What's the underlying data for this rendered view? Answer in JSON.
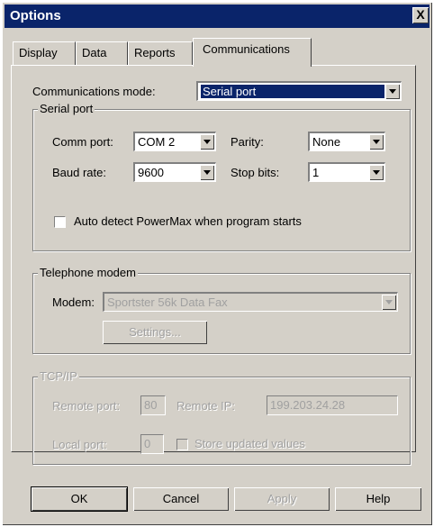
{
  "window": {
    "title": "Options",
    "close_symbol": "X"
  },
  "tabs": [
    {
      "label": "Display"
    },
    {
      "label": "Data"
    },
    {
      "label": "Reports"
    },
    {
      "label": "Communications",
      "active": true
    }
  ],
  "comm_mode": {
    "label": "Communications mode:",
    "value": "Serial port"
  },
  "serial": {
    "title": "Serial port",
    "comm_port_label": "Comm port:",
    "comm_port_value": "COM 2",
    "parity_label": "Parity:",
    "parity_value": "None",
    "baud_label": "Baud rate:",
    "baud_value": "9600",
    "stopbits_label": "Stop bits:",
    "stopbits_value": "1",
    "autodetect_label": "Auto detect PowerMax when program starts"
  },
  "modem": {
    "title": "Telephone modem",
    "modem_label": "Modem:",
    "modem_value": "Sportster 56k Data Fax",
    "settings_label": "Settings..."
  },
  "tcpip": {
    "title": "TCP/IP",
    "remote_port_label": "Remote port:",
    "remote_port_value": "80",
    "remote_ip_label": "Remote IP:",
    "remote_ip_value": "199.203.24.28",
    "local_port_label": "Local port:",
    "local_port_value": "0",
    "store_label": "Store updated values"
  },
  "buttons": {
    "ok": "OK",
    "cancel": "Cancel",
    "apply": "Apply",
    "help": "Help"
  }
}
